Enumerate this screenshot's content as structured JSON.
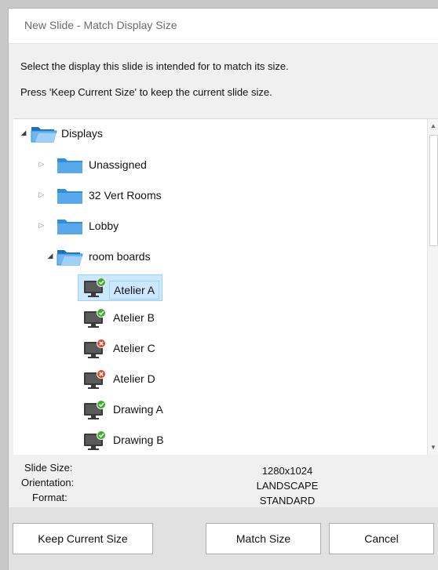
{
  "dialog": {
    "title": "New Slide - Match Display Size",
    "instruction_1": "Select the display this slide is intended for to match its size.",
    "instruction_2": "Press 'Keep Current Size' to keep the current slide size."
  },
  "tree": {
    "root": {
      "label": "Displays",
      "expanded": true
    },
    "folders": [
      {
        "label": "Unassigned",
        "expanded": false
      },
      {
        "label": "32 Vert Rooms",
        "expanded": false
      },
      {
        "label": "Lobby",
        "expanded": false
      },
      {
        "label": "room boards",
        "expanded": true
      }
    ],
    "displays": [
      {
        "label": "Atelier A",
        "status": "online",
        "selected": true
      },
      {
        "label": "Atelier B",
        "status": "online",
        "selected": false
      },
      {
        "label": "Atelier C",
        "status": "offline",
        "selected": false
      },
      {
        "label": "Atelier D",
        "status": "offline",
        "selected": false
      },
      {
        "label": "Drawing A",
        "status": "online",
        "selected": false
      },
      {
        "label": "Drawing B",
        "status": "online",
        "selected": false
      }
    ]
  },
  "info": {
    "slide_size_label": "Slide Size:",
    "orientation_label": "Orientation:",
    "format_label": "Format:",
    "slide_size_value": "1280x1024",
    "orientation_value": "LANDSCAPE",
    "format_value": "STANDARD"
  },
  "buttons": {
    "keep": "Keep Current Size",
    "match": "Match Size",
    "cancel": "Cancel"
  },
  "colors": {
    "selection": "#cce8ff",
    "status_online": "#3dae2b",
    "status_offline": "#d9472b",
    "folder": "#2f8fdc"
  }
}
